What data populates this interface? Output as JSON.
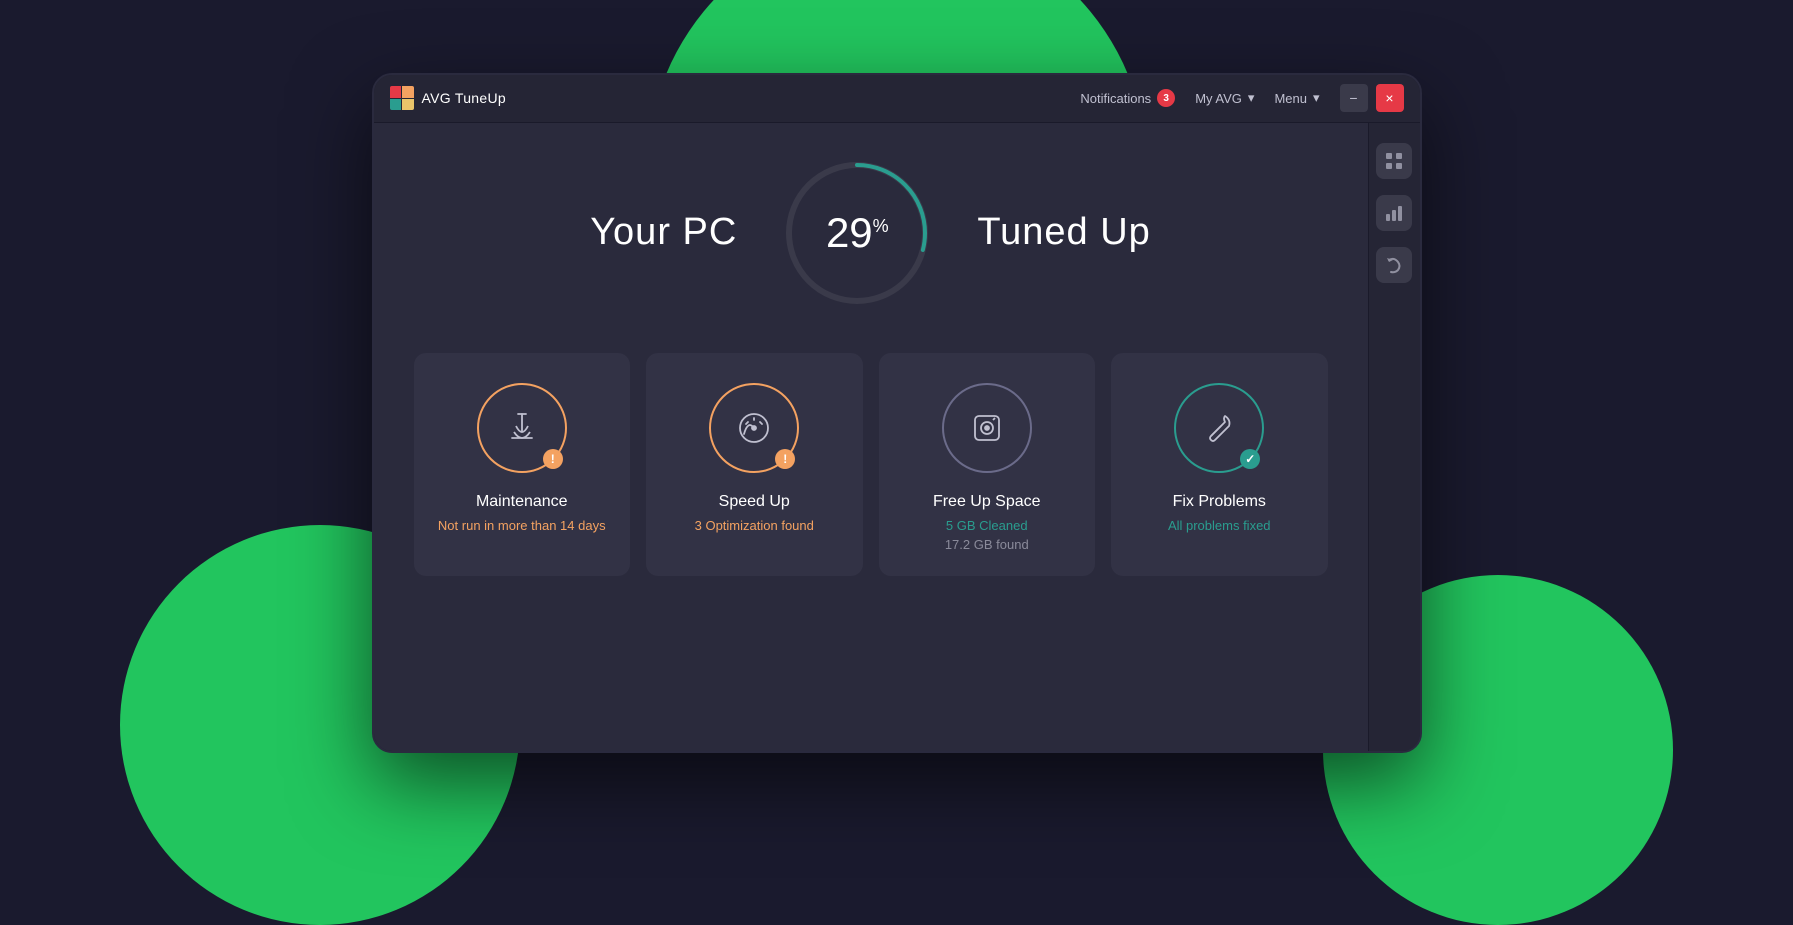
{
  "app": {
    "logo_label": "AVG TuneUp",
    "title": "TuneUp"
  },
  "header": {
    "notifications_label": "Notifications",
    "notifications_count": "3",
    "myavg_label": "My AVG",
    "menu_label": "Menu",
    "minimize_label": "−",
    "close_label": "×"
  },
  "score": {
    "left_label": "Your PC",
    "right_label": "Tuned Up",
    "value": "29",
    "percent": "%",
    "arc_progress": 29,
    "arc_total": 100
  },
  "sidebar": {
    "icons": [
      "grid",
      "bar-chart",
      "undo"
    ]
  },
  "cards": [
    {
      "id": "maintenance",
      "title": "Maintenance",
      "status": "Not run in more than 14 days",
      "sub_status": "",
      "icon_type": "broom",
      "border_color": "orange",
      "alert_type": "orange",
      "alert_symbol": "!"
    },
    {
      "id": "speed-up",
      "title": "Speed Up",
      "status": "3 Optimization found",
      "sub_status": "",
      "icon_type": "gauge",
      "border_color": "orange",
      "alert_type": "orange",
      "alert_symbol": "!"
    },
    {
      "id": "free-up-space",
      "title": "Free Up Space",
      "status": "5 GB Cleaned",
      "sub_status": "17.2 GB found",
      "icon_type": "disk",
      "border_color": "gray",
      "alert_type": "none",
      "alert_symbol": ""
    },
    {
      "id": "fix-problems",
      "title": "Fix Problems",
      "status": "All problems fixed",
      "sub_status": "",
      "icon_type": "wrench",
      "border_color": "green",
      "alert_type": "green",
      "alert_symbol": "✓"
    }
  ]
}
